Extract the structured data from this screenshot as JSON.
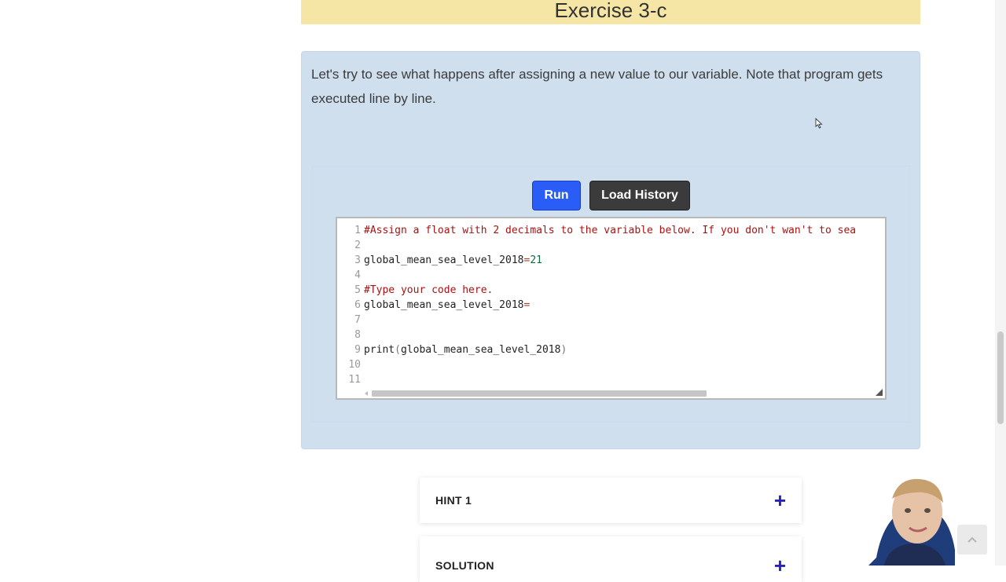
{
  "exercise": {
    "title": "Exercise 3-c",
    "description": "Let's try to see what happens after assigning a new value to our variable. Note that program gets executed line by line."
  },
  "toolbar": {
    "run_label": "Run",
    "load_history_label": "Load History"
  },
  "editor": {
    "lines": [
      {
        "num": "1",
        "comment": "#Assign a float with 2 decimals to the variable below. If you don't wan't to sea"
      },
      {
        "num": "2"
      },
      {
        "num": "3",
        "name": "global_mean_sea_level_2018",
        "op": "=",
        "value": "21"
      },
      {
        "num": "4"
      },
      {
        "num": "5",
        "comment": "#Type your code here."
      },
      {
        "num": "6",
        "name": "global_mean_sea_level_2018",
        "op": "="
      },
      {
        "num": "7"
      },
      {
        "num": "8"
      },
      {
        "num": "9",
        "func": "print",
        "open": "(",
        "arg": "global_mean_sea_level_2018",
        "close": ")"
      },
      {
        "num": "10"
      },
      {
        "num": "11"
      }
    ]
  },
  "accordion": {
    "hint_label": "HINT 1",
    "solution_label": "SOLUTION",
    "expand_glyph": "+"
  },
  "icons": {
    "cursor": "mouse-pointer-icon",
    "expand": "plus-icon",
    "back_to_top": "chevron-up-icon"
  },
  "colors": {
    "header_bg": "#f6e6a6",
    "box_bg": "#cfdfee",
    "run_button": "#2a5df5",
    "load_history_button": "#3b3b3b",
    "plus": "#2a22b8"
  }
}
